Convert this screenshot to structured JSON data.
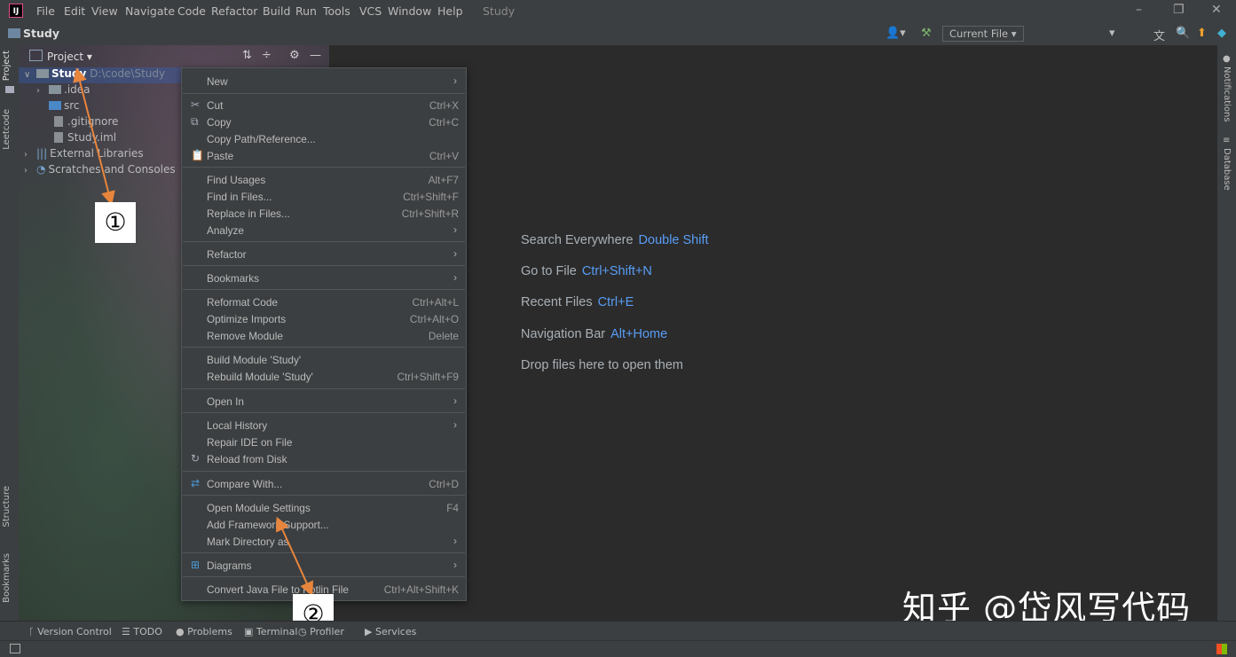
{
  "menubar": {
    "logo": "IJ",
    "items": [
      "File",
      "Edit",
      "View",
      "Navigate",
      "Code",
      "Refactor",
      "Build",
      "Run",
      "Tools",
      "VCS",
      "Window",
      "Help"
    ],
    "title": "Study"
  },
  "navbar": {
    "breadcrumb": "Study",
    "run_config": "Current File"
  },
  "left_tabs": [
    "Project",
    "Leetcode",
    "Structure",
    "Bookmarks"
  ],
  "right_tabs": [
    "Notifications",
    "Database"
  ],
  "project_panel": {
    "header": "Project",
    "tree": [
      {
        "name": "Study",
        "path": "D:\\code\\Study"
      },
      {
        "name": ".idea"
      },
      {
        "name": "src"
      },
      {
        "name": ".gitignore"
      },
      {
        "name": "Study.iml"
      },
      {
        "name": "External Libraries"
      },
      {
        "name": "Scratches and Consoles"
      }
    ]
  },
  "context_menu": [
    {
      "label": "New",
      "shortcut": "",
      "submenu": true
    },
    {
      "label": "Cut",
      "shortcut": "Ctrl+X"
    },
    {
      "label": "Copy",
      "shortcut": "Ctrl+C"
    },
    {
      "label": "Copy Path/Reference...",
      "shortcut": ""
    },
    {
      "label": "Paste",
      "shortcut": "Ctrl+V"
    },
    {
      "label": "Find Usages",
      "shortcut": "Alt+F7"
    },
    {
      "label": "Find in Files...",
      "shortcut": "Ctrl+Shift+F"
    },
    {
      "label": "Replace in Files...",
      "shortcut": "Ctrl+Shift+R"
    },
    {
      "label": "Analyze",
      "shortcut": "",
      "submenu": true
    },
    {
      "label": "Refactor",
      "shortcut": "",
      "submenu": true
    },
    {
      "label": "Bookmarks",
      "shortcut": "",
      "submenu": true
    },
    {
      "label": "Reformat Code",
      "shortcut": "Ctrl+Alt+L"
    },
    {
      "label": "Optimize Imports",
      "shortcut": "Ctrl+Alt+O"
    },
    {
      "label": "Remove Module",
      "shortcut": "Delete"
    },
    {
      "label": "Build Module 'Study'",
      "shortcut": ""
    },
    {
      "label": "Rebuild Module 'Study'",
      "shortcut": "Ctrl+Shift+F9"
    },
    {
      "label": "Open In",
      "shortcut": "",
      "submenu": true
    },
    {
      "label": "Local History",
      "shortcut": "",
      "submenu": true
    },
    {
      "label": "Repair IDE on File",
      "shortcut": ""
    },
    {
      "label": "Reload from Disk",
      "shortcut": ""
    },
    {
      "label": "Compare With...",
      "shortcut": "Ctrl+D"
    },
    {
      "label": "Open Module Settings",
      "shortcut": "F4"
    },
    {
      "label": "Add Framework Support...",
      "shortcut": ""
    },
    {
      "label": "Mark Directory as",
      "shortcut": "",
      "submenu": true
    },
    {
      "label": "Diagrams",
      "shortcut": "",
      "submenu": true
    },
    {
      "label": "Convert Java File to Kotlin File",
      "shortcut": "Ctrl+Alt+Shift+K"
    }
  ],
  "welcome": [
    {
      "text": "Search Everywhere",
      "key": "Double Shift"
    },
    {
      "text": "Go to File",
      "key": "Ctrl+Shift+N"
    },
    {
      "text": "Recent Files",
      "key": "Ctrl+E"
    },
    {
      "text": "Navigation Bar",
      "key": "Alt+Home"
    },
    {
      "text": "Drop files here to open them",
      "key": ""
    }
  ],
  "watermark": "知乎 @岱风写代码",
  "annotations": [
    "①",
    "②"
  ],
  "bottom_tabs": [
    "Version Control",
    "TODO",
    "Problems",
    "Terminal",
    "Profiler",
    "Services"
  ],
  "colors": {
    "accent": "#589df6",
    "arrow": "#e8853c"
  }
}
